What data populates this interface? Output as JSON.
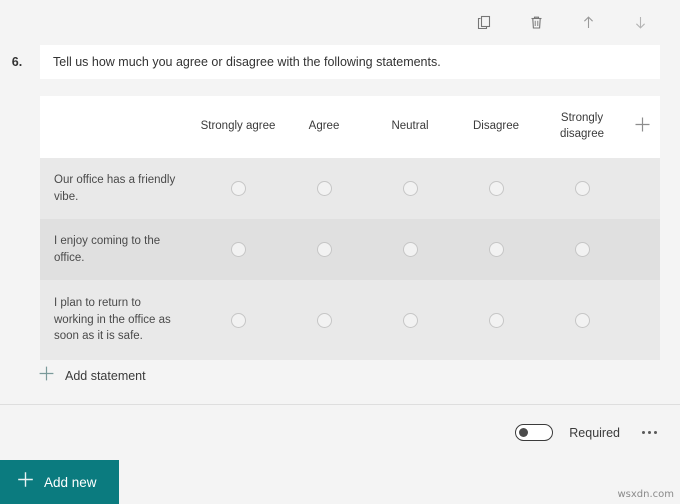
{
  "toolbar": {
    "items": [
      {
        "name": "copy-icon",
        "label": "Copy question"
      },
      {
        "name": "delete-icon",
        "label": "Delete question"
      },
      {
        "name": "move-up-icon",
        "label": "Move question up"
      },
      {
        "name": "move-down-icon",
        "label": "Move question down"
      }
    ]
  },
  "question": {
    "number": "6.",
    "title": "Tell us how much you agree or disagree with the following statements."
  },
  "matrix": {
    "columns": [
      "Strongly agree",
      "Agree",
      "Neutral",
      "Disagree",
      "Strongly disagree"
    ],
    "add_column_icon": "plus-icon",
    "rows": [
      {
        "statement": "Our office has a friendly vibe."
      },
      {
        "statement": "I enjoy coming to the office."
      },
      {
        "statement": "I plan to return to working in the office as soon as it is safe."
      }
    ]
  },
  "add_statement": {
    "label": "Add statement",
    "icon": "plus-icon"
  },
  "footer": {
    "required_label": "Required",
    "required_on": false,
    "more_label": "More settings"
  },
  "add_new": {
    "label": "Add new",
    "icon": "plus-icon"
  },
  "watermark": "wsxdn.com",
  "colors": {
    "accent": "#0b7b7f",
    "page_bg": "#f4f4f4",
    "row_bg": "#e9e9e9",
    "row_alt_bg": "#e0e0e0",
    "card_bg": "#ffffff"
  }
}
